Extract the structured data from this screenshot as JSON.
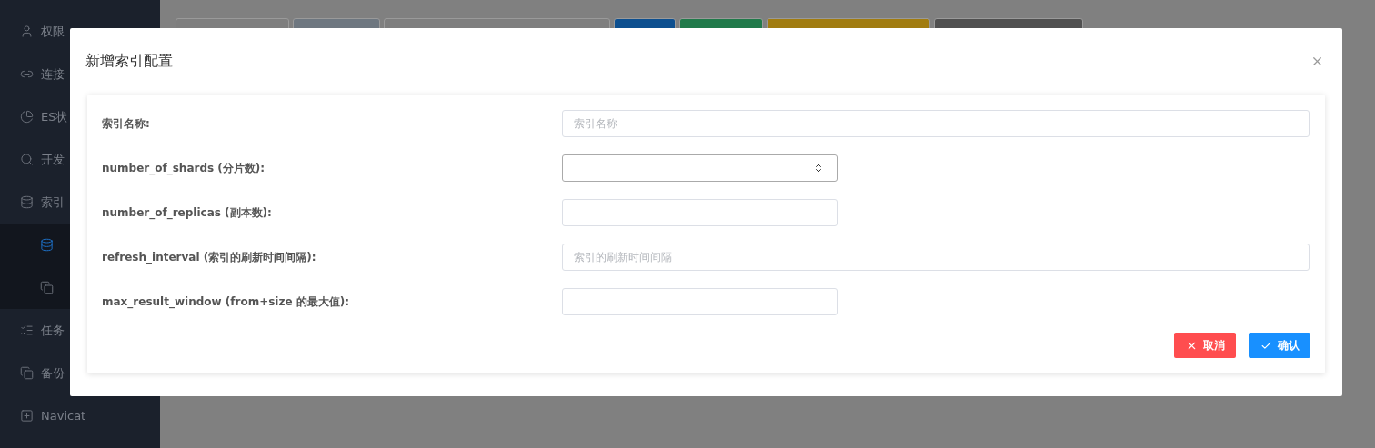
{
  "sidebar": {
    "items": [
      {
        "label": "权限",
        "selected": false
      },
      {
        "label": "连接",
        "selected": false
      },
      {
        "label": "ES状",
        "selected": false
      },
      {
        "label": "开发",
        "selected": false
      },
      {
        "label": "索引",
        "selected": false,
        "expanded": true,
        "children": [
          {
            "selected": true
          },
          {
            "selected": false
          }
        ]
      },
      {
        "label": "任务",
        "selected": false
      },
      {
        "label": "备份",
        "selected": false
      },
      {
        "label": "Navicat",
        "selected": false
      }
    ]
  },
  "toolbar": {
    "buttons": [
      {
        "kind": "field"
      },
      {
        "kind": "tag"
      },
      {
        "kind": "wide-field"
      },
      {
        "kind": "primary"
      },
      {
        "kind": "success"
      },
      {
        "kind": "warning"
      },
      {
        "kind": "default"
      }
    ]
  },
  "dialog": {
    "title": "新增索引配置",
    "fields": [
      {
        "label": "索引名称:",
        "kind": "text",
        "placeholder": "索引名称"
      },
      {
        "label": "number_of_shards (分片数):",
        "kind": "stepper"
      },
      {
        "label": "number_of_replicas (副本数):",
        "kind": "number"
      },
      {
        "label": "refresh_interval (索引的刷新时间间隔):",
        "kind": "text",
        "placeholder": "索引的刷新时间间隔"
      },
      {
        "label": "max_result_window (from+size 的最大值):",
        "kind": "number"
      }
    ],
    "buttons": [
      {
        "label": "取消",
        "kind": "cancel"
      },
      {
        "label": "确认",
        "kind": "confirm"
      }
    ]
  }
}
